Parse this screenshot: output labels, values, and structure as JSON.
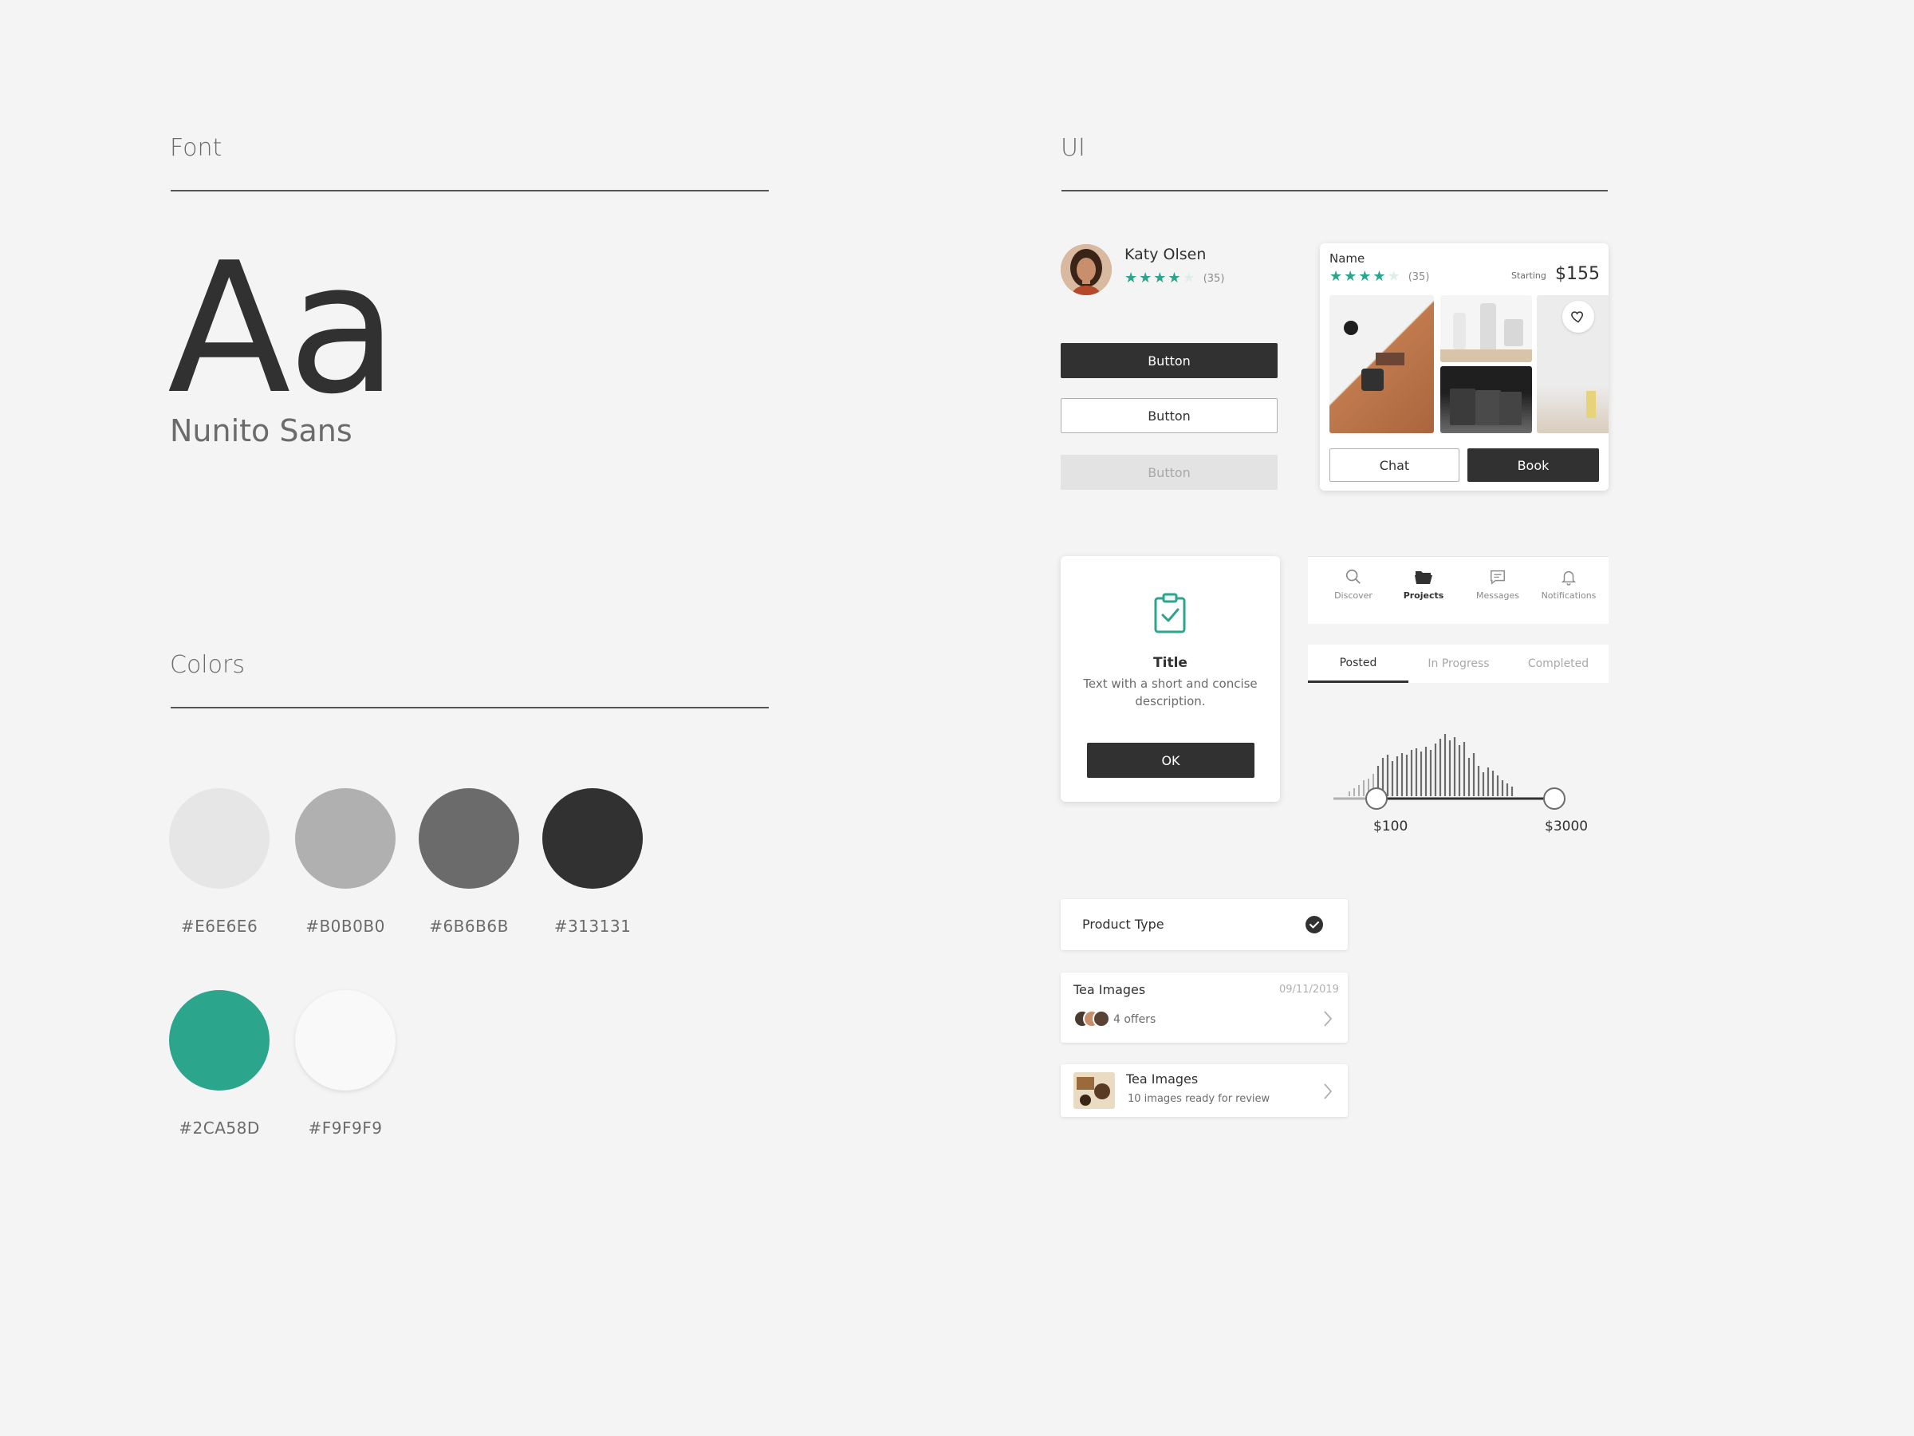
{
  "font_section": {
    "title": "Font",
    "specimen": "Aa",
    "font_name": "Nunito Sans"
  },
  "colors_section": {
    "title": "Colors",
    "swatches": [
      {
        "hex": "#E6E6E6",
        "label": "#E6E6E6"
      },
      {
        "hex": "#B0B0B0",
        "label": "#B0B0B0"
      },
      {
        "hex": "#6B6B6B",
        "label": "#6B6B6B"
      },
      {
        "hex": "#313131",
        "label": "#313131"
      },
      {
        "hex": "#2CA58D",
        "label": "#2CA58D"
      },
      {
        "hex": "#F9F9F9",
        "label": "#F9F9F9"
      }
    ]
  },
  "ui_section": {
    "title": "UI"
  },
  "profile": {
    "name": "Katy Olsen",
    "rating": 4,
    "review_count": "(35)"
  },
  "buttons": {
    "primary_label": "Button",
    "outline_label": "Button",
    "disabled_label": "Button"
  },
  "product_card": {
    "name": "Name",
    "rating": 4,
    "review_count": "(35)",
    "price_prefix": "Starting",
    "price": "$155",
    "chat_label": "Chat",
    "book_label": "Book",
    "icon": "heart-icon"
  },
  "dialog": {
    "icon": "clipboard-check-icon",
    "title": "Title",
    "description": "Text with a short and concise description.",
    "ok_label": "OK"
  },
  "nav": {
    "items": [
      {
        "label": "Discover",
        "icon": "search-icon",
        "active": false
      },
      {
        "label": "Projects",
        "icon": "folder-icon",
        "active": true
      },
      {
        "label": "Messages",
        "icon": "message-icon",
        "active": false
      },
      {
        "label": "Notifications",
        "icon": "bell-icon",
        "active": false
      }
    ]
  },
  "tabs": {
    "items": [
      {
        "label": "Posted",
        "active": true
      },
      {
        "label": "In Progress",
        "active": false
      },
      {
        "label": "Completed",
        "active": false
      }
    ]
  },
  "range_slider": {
    "min_label": "$100",
    "max_label": "$3000"
  },
  "product_type": {
    "label": "Product Type",
    "checked": true
  },
  "list": {
    "item1": {
      "title": "Tea Images",
      "date": "09/11/2019",
      "offers": "4 offers"
    },
    "item2": {
      "title": "Tea Images",
      "subtitle": "10 images ready for review"
    }
  },
  "colors": {
    "accent": "#2CA58D",
    "dark": "#313131",
    "mid": "#6B6B6B",
    "light": "#B0B0B0",
    "lighter": "#E6E6E6",
    "white": "#F9F9F9",
    "background": "#F4F4F4"
  }
}
